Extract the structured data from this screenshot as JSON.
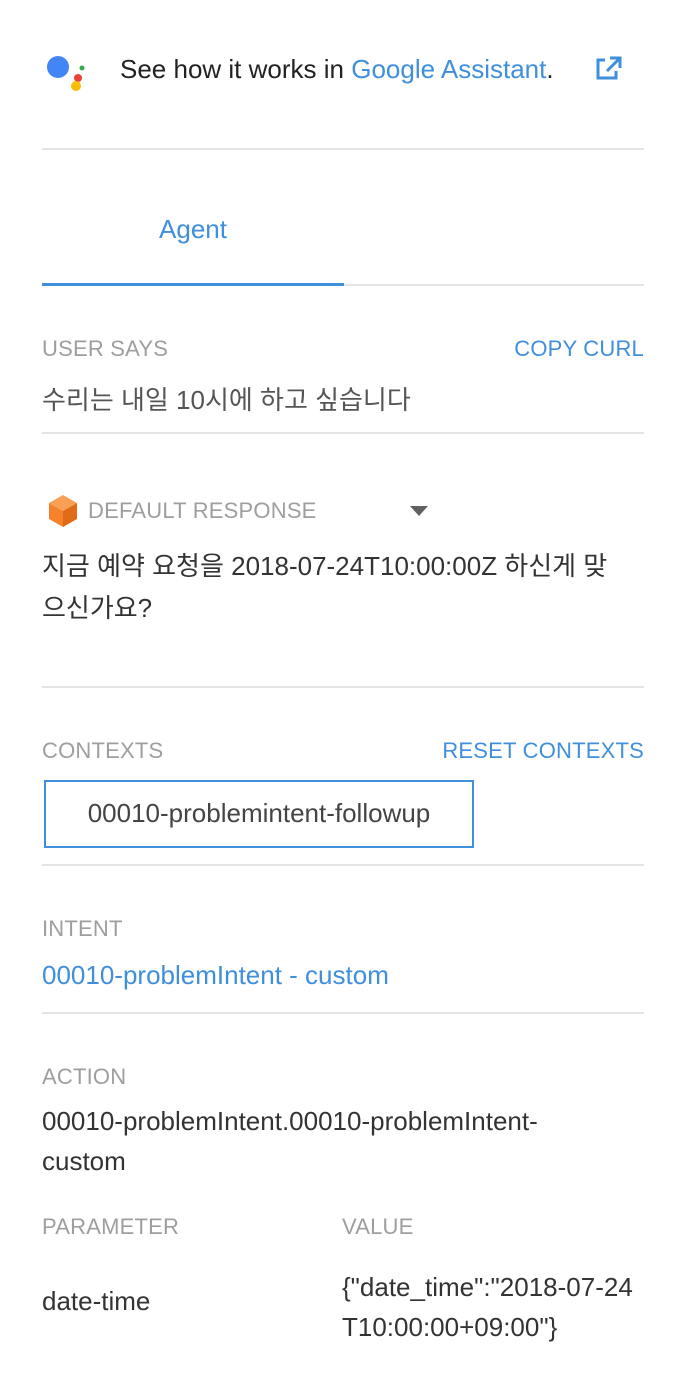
{
  "assistant": {
    "prefix": "See how it works in ",
    "link": "Google Assistant",
    "suffix": ".",
    "colors": {
      "blue": "#4285f4",
      "red": "#ea4335",
      "yellow": "#fbbc05",
      "green": "#34a853"
    }
  },
  "tabs": [
    {
      "label": "Agent",
      "active": true
    }
  ],
  "user_says": {
    "label": "USER SAYS",
    "action": "COPY CURL",
    "text": "수리는 내일 10시에 하고 싶습니다"
  },
  "response": {
    "label": "DEFAULT RESPONSE",
    "text_line1": "지금 예약 요청을 2018-07-24T10:00:00Z 하신게 맞",
    "text_line2": "으신가요?"
  },
  "contexts": {
    "label": "CONTEXTS",
    "action": "RESET CONTEXTS",
    "items": [
      "00010-problemintent-followup"
    ]
  },
  "intent": {
    "label": "INTENT",
    "value": "00010-problemIntent - custom"
  },
  "action": {
    "label": "ACTION",
    "value_line1": "00010-problemIntent.00010-problemIntent-",
    "value_line2": "custom"
  },
  "parameters": {
    "header_param": "PARAMETER",
    "header_value": "VALUE",
    "rows": [
      {
        "name": "date-time",
        "value_line1": "{\"date_time\":\"2018-07-24",
        "value_line2": "T10:00:00+09:00\"}"
      }
    ]
  },
  "theme": {
    "accent": "#3f8fdc",
    "muted": "#9e9e9e",
    "divider": "#e4e4e4",
    "cube": "#f5822a"
  }
}
